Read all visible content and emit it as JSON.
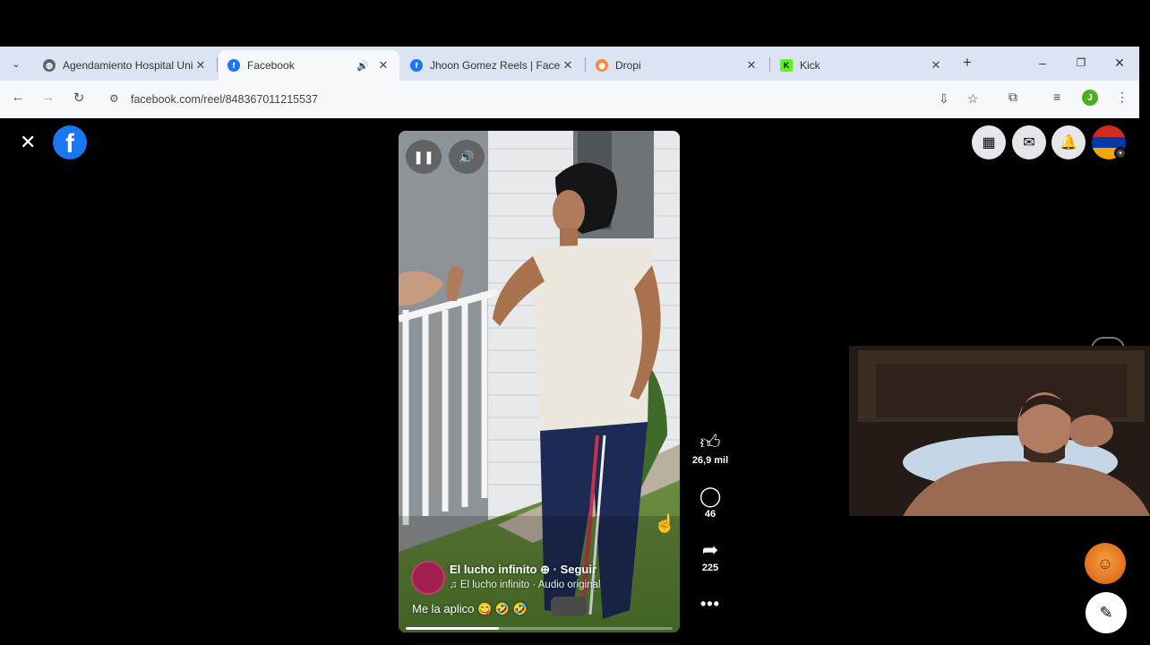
{
  "browser": {
    "tabs": [
      {
        "title": "Agendamiento Hospital Uni",
        "favicon": "globe-icon",
        "active": false
      },
      {
        "title": "Facebook",
        "favicon": "facebook-icon",
        "active": true,
        "audio": true
      },
      {
        "title": "Jhoon Gomez Reels | Facebo",
        "favicon": "facebook-icon",
        "active": false
      },
      {
        "title": "Dropi",
        "favicon": "dropi-icon",
        "active": false
      },
      {
        "title": "Kick",
        "favicon": "kick-icon",
        "active": false
      }
    ],
    "url": "facebook.com/reel/848367011215537",
    "profile_initial": "J"
  },
  "reel": {
    "author": "El lucho infinito",
    "follow_label": "Seguir",
    "audio": "El lucho infinito · Audio original",
    "caption": "Me la aplico 😋 🤣 🤣",
    "progress": 0.35,
    "likes": "26,9 mil",
    "comments": "46",
    "shares": "225"
  },
  "colors": {
    "facebook_blue": "#1877f2",
    "tabstrip": "#dbe4f2",
    "toolbar": "#f6f8fc"
  }
}
